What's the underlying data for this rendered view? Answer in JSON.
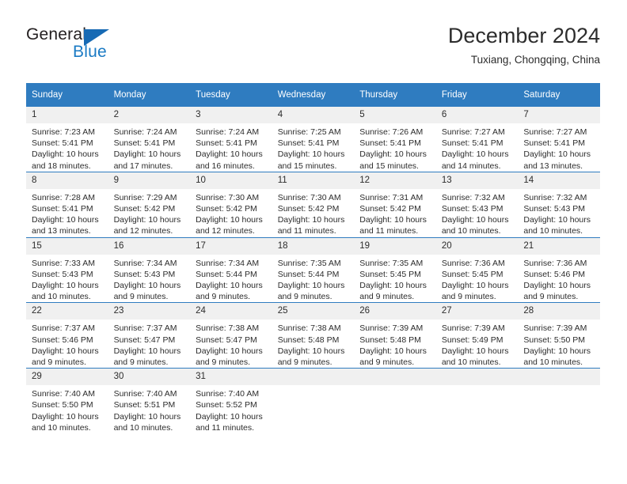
{
  "brand": {
    "name_part1": "General",
    "name_part2": "Blue",
    "triangle_color": "#176ab4",
    "blue_color": "#1a7ac4"
  },
  "header": {
    "title": "December 2024",
    "subtitle": "Tuxiang, Chongqing, China"
  },
  "theme": {
    "header_bg": "#2f7cc0",
    "daynum_bg": "#f0f0f0",
    "row_divider": "#2f7cc0",
    "text": "#2c2c2c"
  },
  "weekdays": [
    "Sunday",
    "Monday",
    "Tuesday",
    "Wednesday",
    "Thursday",
    "Friday",
    "Saturday"
  ],
  "weeks": [
    [
      {
        "day": "1",
        "sunrise": "Sunrise: 7:23 AM",
        "sunset": "Sunset: 5:41 PM",
        "daylight1": "Daylight: 10 hours",
        "daylight2": "and 18 minutes."
      },
      {
        "day": "2",
        "sunrise": "Sunrise: 7:24 AM",
        "sunset": "Sunset: 5:41 PM",
        "daylight1": "Daylight: 10 hours",
        "daylight2": "and 17 minutes."
      },
      {
        "day": "3",
        "sunrise": "Sunrise: 7:24 AM",
        "sunset": "Sunset: 5:41 PM",
        "daylight1": "Daylight: 10 hours",
        "daylight2": "and 16 minutes."
      },
      {
        "day": "4",
        "sunrise": "Sunrise: 7:25 AM",
        "sunset": "Sunset: 5:41 PM",
        "daylight1": "Daylight: 10 hours",
        "daylight2": "and 15 minutes."
      },
      {
        "day": "5",
        "sunrise": "Sunrise: 7:26 AM",
        "sunset": "Sunset: 5:41 PM",
        "daylight1": "Daylight: 10 hours",
        "daylight2": "and 15 minutes."
      },
      {
        "day": "6",
        "sunrise": "Sunrise: 7:27 AM",
        "sunset": "Sunset: 5:41 PM",
        "daylight1": "Daylight: 10 hours",
        "daylight2": "and 14 minutes."
      },
      {
        "day": "7",
        "sunrise": "Sunrise: 7:27 AM",
        "sunset": "Sunset: 5:41 PM",
        "daylight1": "Daylight: 10 hours",
        "daylight2": "and 13 minutes."
      }
    ],
    [
      {
        "day": "8",
        "sunrise": "Sunrise: 7:28 AM",
        "sunset": "Sunset: 5:41 PM",
        "daylight1": "Daylight: 10 hours",
        "daylight2": "and 13 minutes."
      },
      {
        "day": "9",
        "sunrise": "Sunrise: 7:29 AM",
        "sunset": "Sunset: 5:42 PM",
        "daylight1": "Daylight: 10 hours",
        "daylight2": "and 12 minutes."
      },
      {
        "day": "10",
        "sunrise": "Sunrise: 7:30 AM",
        "sunset": "Sunset: 5:42 PM",
        "daylight1": "Daylight: 10 hours",
        "daylight2": "and 12 minutes."
      },
      {
        "day": "11",
        "sunrise": "Sunrise: 7:30 AM",
        "sunset": "Sunset: 5:42 PM",
        "daylight1": "Daylight: 10 hours",
        "daylight2": "and 11 minutes."
      },
      {
        "day": "12",
        "sunrise": "Sunrise: 7:31 AM",
        "sunset": "Sunset: 5:42 PM",
        "daylight1": "Daylight: 10 hours",
        "daylight2": "and 11 minutes."
      },
      {
        "day": "13",
        "sunrise": "Sunrise: 7:32 AM",
        "sunset": "Sunset: 5:43 PM",
        "daylight1": "Daylight: 10 hours",
        "daylight2": "and 10 minutes."
      },
      {
        "day": "14",
        "sunrise": "Sunrise: 7:32 AM",
        "sunset": "Sunset: 5:43 PM",
        "daylight1": "Daylight: 10 hours",
        "daylight2": "and 10 minutes."
      }
    ],
    [
      {
        "day": "15",
        "sunrise": "Sunrise: 7:33 AM",
        "sunset": "Sunset: 5:43 PM",
        "daylight1": "Daylight: 10 hours",
        "daylight2": "and 10 minutes."
      },
      {
        "day": "16",
        "sunrise": "Sunrise: 7:34 AM",
        "sunset": "Sunset: 5:43 PM",
        "daylight1": "Daylight: 10 hours",
        "daylight2": "and 9 minutes."
      },
      {
        "day": "17",
        "sunrise": "Sunrise: 7:34 AM",
        "sunset": "Sunset: 5:44 PM",
        "daylight1": "Daylight: 10 hours",
        "daylight2": "and 9 minutes."
      },
      {
        "day": "18",
        "sunrise": "Sunrise: 7:35 AM",
        "sunset": "Sunset: 5:44 PM",
        "daylight1": "Daylight: 10 hours",
        "daylight2": "and 9 minutes."
      },
      {
        "day": "19",
        "sunrise": "Sunrise: 7:35 AM",
        "sunset": "Sunset: 5:45 PM",
        "daylight1": "Daylight: 10 hours",
        "daylight2": "and 9 minutes."
      },
      {
        "day": "20",
        "sunrise": "Sunrise: 7:36 AM",
        "sunset": "Sunset: 5:45 PM",
        "daylight1": "Daylight: 10 hours",
        "daylight2": "and 9 minutes."
      },
      {
        "day": "21",
        "sunrise": "Sunrise: 7:36 AM",
        "sunset": "Sunset: 5:46 PM",
        "daylight1": "Daylight: 10 hours",
        "daylight2": "and 9 minutes."
      }
    ],
    [
      {
        "day": "22",
        "sunrise": "Sunrise: 7:37 AM",
        "sunset": "Sunset: 5:46 PM",
        "daylight1": "Daylight: 10 hours",
        "daylight2": "and 9 minutes."
      },
      {
        "day": "23",
        "sunrise": "Sunrise: 7:37 AM",
        "sunset": "Sunset: 5:47 PM",
        "daylight1": "Daylight: 10 hours",
        "daylight2": "and 9 minutes."
      },
      {
        "day": "24",
        "sunrise": "Sunrise: 7:38 AM",
        "sunset": "Sunset: 5:47 PM",
        "daylight1": "Daylight: 10 hours",
        "daylight2": "and 9 minutes."
      },
      {
        "day": "25",
        "sunrise": "Sunrise: 7:38 AM",
        "sunset": "Sunset: 5:48 PM",
        "daylight1": "Daylight: 10 hours",
        "daylight2": "and 9 minutes."
      },
      {
        "day": "26",
        "sunrise": "Sunrise: 7:39 AM",
        "sunset": "Sunset: 5:48 PM",
        "daylight1": "Daylight: 10 hours",
        "daylight2": "and 9 minutes."
      },
      {
        "day": "27",
        "sunrise": "Sunrise: 7:39 AM",
        "sunset": "Sunset: 5:49 PM",
        "daylight1": "Daylight: 10 hours",
        "daylight2": "and 10 minutes."
      },
      {
        "day": "28",
        "sunrise": "Sunrise: 7:39 AM",
        "sunset": "Sunset: 5:50 PM",
        "daylight1": "Daylight: 10 hours",
        "daylight2": "and 10 minutes."
      }
    ],
    [
      {
        "day": "29",
        "sunrise": "Sunrise: 7:40 AM",
        "sunset": "Sunset: 5:50 PM",
        "daylight1": "Daylight: 10 hours",
        "daylight2": "and 10 minutes."
      },
      {
        "day": "30",
        "sunrise": "Sunrise: 7:40 AM",
        "sunset": "Sunset: 5:51 PM",
        "daylight1": "Daylight: 10 hours",
        "daylight2": "and 10 minutes."
      },
      {
        "day": "31",
        "sunrise": "Sunrise: 7:40 AM",
        "sunset": "Sunset: 5:52 PM",
        "daylight1": "Daylight: 10 hours",
        "daylight2": "and 11 minutes."
      },
      {
        "day": "",
        "sunrise": "",
        "sunset": "",
        "daylight1": "",
        "daylight2": ""
      },
      {
        "day": "",
        "sunrise": "",
        "sunset": "",
        "daylight1": "",
        "daylight2": ""
      },
      {
        "day": "",
        "sunrise": "",
        "sunset": "",
        "daylight1": "",
        "daylight2": ""
      },
      {
        "day": "",
        "sunrise": "",
        "sunset": "",
        "daylight1": "",
        "daylight2": ""
      }
    ]
  ]
}
